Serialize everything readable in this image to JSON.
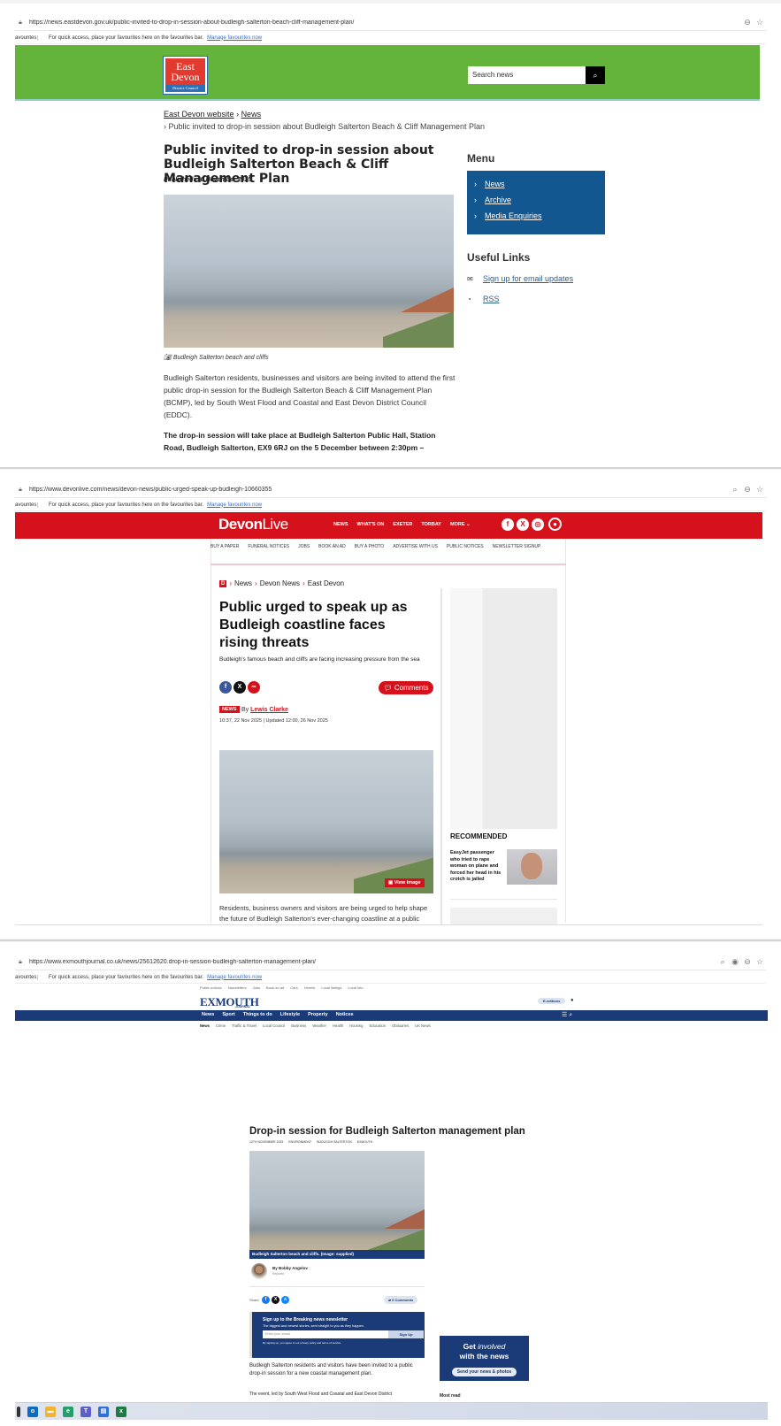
{
  "windows": [
    {
      "url": "https://news.eastdevon.gov.uk/public-invited-to-drop-in-session-about-budleigh-salterton-beach-cliff-management-plan/"
    },
    {
      "url": "https://www.devonlive.com/news/devon-news/public-urged-speak-up-budleigh-10660355"
    },
    {
      "url": "https://www.exmouthjournal.co.uk/news/25612620.drop-in-session-budleigh-salterton-management-plan/"
    }
  ],
  "favbar": {
    "clipped": "avourites",
    "text": "For quick access, place your favourites here on the favourites bar.",
    "link": "Manage favourites now"
  },
  "eastdevon": {
    "logo": {
      "line1": "East",
      "line2": "Devon",
      "line3": "District Council"
    },
    "search_placeholder": "Search news",
    "breadcrumb": {
      "home": "East Devon website",
      "section": "News",
      "current": "Public invited to drop-in session about Budleigh Salterton Beach & Cliff Management Plan"
    },
    "title": "Public invited to drop-in session about Budleigh Salterton Beach & Cliff Management Plan",
    "published": "Published: 10 November 2025",
    "caption": "Budleigh Salterton beach and cliffs",
    "body1": "Budleigh Salterton residents, businesses and visitors are being invited to attend the first public drop-in session for the Budleigh Salterton Beach & Cliff Management Plan (BCMP), led by South West Flood and Coastal and East Devon District Council (EDDC).",
    "body2": "The drop-in session will take place at Budleigh Salterton Public Hall, Station Road, Budleigh Salterton, EX9 6RJ on the 5 December between 2:30pm –",
    "menu_heading": "Menu",
    "menu": [
      "News",
      "Archive",
      "Media Enquiries"
    ],
    "useful_heading": "Useful Links",
    "useful": [
      "Sign up for email updates",
      "RSS"
    ]
  },
  "devonlive": {
    "logo_bold": "Devon",
    "logo_light": "Live",
    "nav": [
      "NEWS",
      "WHAT'S ON",
      "EXETER",
      "TORBAY",
      "MORE ⌄"
    ],
    "subnav": [
      "BUY A PAPER",
      "FUNERAL NOTICES",
      "JOBS",
      "BOOK AN AD",
      "BUY A PHOTO",
      "ADVERTISE WITH US",
      "PUBLIC NOTICES",
      "NEWSLETTER SIGNUP"
    ],
    "breadcrumb": [
      "News",
      "Devon News",
      "East Devon"
    ],
    "breadcrumb_badge": "D",
    "title": "Public urged to speak up as Budleigh coastline faces rising threats",
    "standfirst": "Budleigh's famous beach and cliffs are facing increasing pressure from the sea",
    "comments": "Comments",
    "badge": "NEWS",
    "by": "By",
    "author": "Lewis Clarke",
    "time": "10:37, 22 Nov 2025  |  Updated 12:00, 26 Nov 2025",
    "view_image": "View Image",
    "body": "Residents, business owners and visitors are being urged to help shape the future of Budleigh Salterton's ever-changing coastline at a public",
    "recommended": "RECOMMENDED",
    "rec_title": "EasyJet passenger who tried to rape woman on plane and forced her head in his crotch is jailed"
  },
  "exmouth": {
    "topnav": [
      "Public notices",
      "Newsletters",
      "Jobs",
      "Book an ad",
      "Cars",
      "Homes",
      "Local listings",
      "Local info"
    ],
    "logo": "EXMOUTH",
    "logo_sub": "JOURNAL",
    "editions": "E-editions",
    "nav": [
      "News",
      "Sport",
      "Things to do",
      "Lifestyle",
      "Property",
      "Notices"
    ],
    "subnav": [
      "News",
      "Crime",
      "Traffic & Travel",
      "Local Council",
      "Business",
      "Weather",
      "Health",
      "Housing",
      "Education",
      "Obituaries",
      "UK News"
    ],
    "title": "Drop-in session for Budleigh Salterton management plan",
    "tags": [
      "12th November 2025",
      "Environment",
      "Budleigh Salterton",
      "Exmouth"
    ],
    "caption": "Budleigh Salterton beach and cliffs. (Image: supplied)",
    "author": "By Bobby Angelov",
    "role": "Reporter",
    "share_label": "Share",
    "comments": "0 Comments",
    "newsletter": {
      "heading": "Sign up to the Breaking news newsletter",
      "sub": "The biggest and newest stories, sent straight to you as they happen.",
      "placeholder": "Enter your email",
      "button": "Sign Up",
      "privacy": "By signing up, you agree to our privacy policy and terms of service."
    },
    "body1": "Budleigh Salterton residents and visitors have been invited to a public drop-in session for a new coastal management plan.",
    "body2": "The event, led by South West Flood and Coastal and East Devon District",
    "promo_line1a": "Get ",
    "promo_line1b": "involved",
    "promo_line2": "with the news",
    "promo_button": "Send your news & photos",
    "most_read": "Most read"
  }
}
